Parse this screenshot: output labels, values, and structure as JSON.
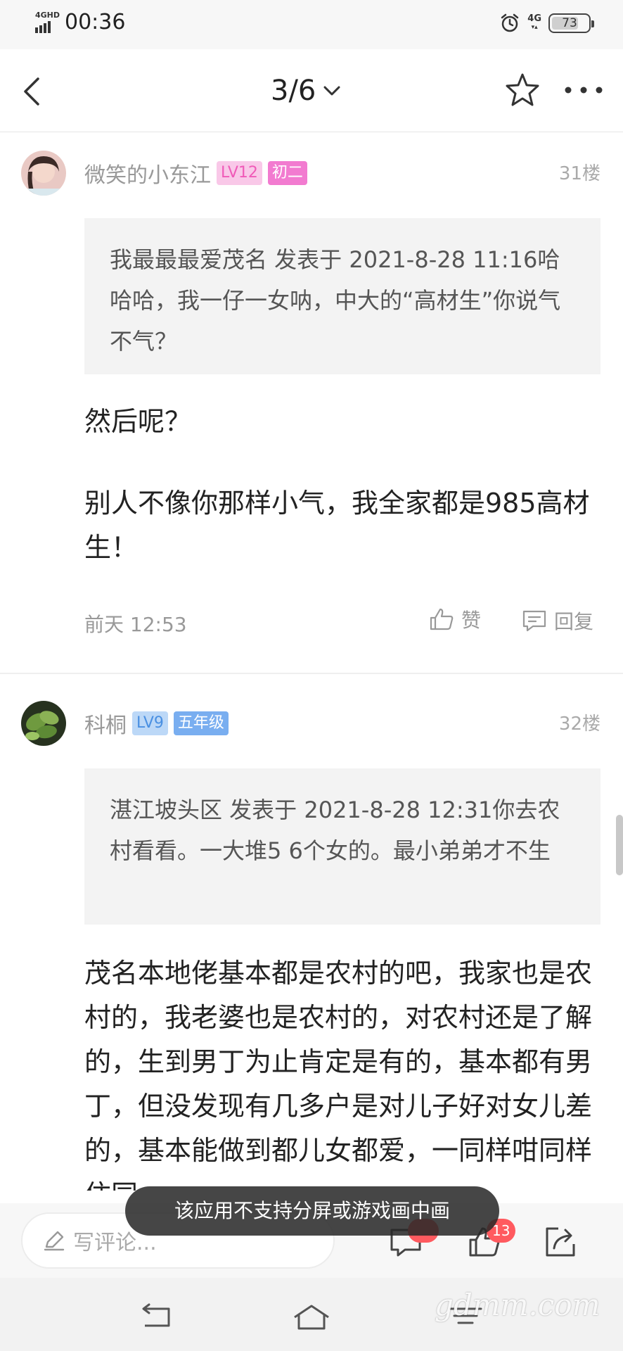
{
  "status_bar": {
    "network": "4GHD",
    "time": "00:36",
    "net_right": "4G",
    "battery": "73",
    "battery_level": 0.73
  },
  "header": {
    "page_indicator": "3/6"
  },
  "posts": [
    {
      "username": "微笑的小东江",
      "badges": [
        {
          "text": "LV12",
          "bg": "#f9c8e8",
          "color": "#f05ab8"
        },
        {
          "text": "初二",
          "bg": "#f27bd0",
          "color": "#ffffff"
        }
      ],
      "floor": "31楼",
      "quote": "我最最最爱茂名 发表于 2021-8-28 11:16哈哈哈，我一仔一女呐，中大的“高材生”你说气不气？",
      "paragraphs": [
        "然后呢？",
        "别人不像你那样小气，我全家都是985高材生！"
      ],
      "time": "前天 12:53",
      "like_label": "赞",
      "reply_label": "回复"
    },
    {
      "username": "科桐",
      "badges": [
        {
          "text": "LV9",
          "bg": "#bcd8f7",
          "color": "#4a90e2"
        },
        {
          "text": "五年级",
          "bg": "#79aef0",
          "color": "#ffffff"
        }
      ],
      "floor": "32楼",
      "quote": "湛江坡头区 发表于 2021-8-28 12:31你去农村看看。一大堆5 6个女的。最小弟弟才不生",
      "paragraphs": [
        "茂名本地佬基本都是农村的吧，我家也是农村的，我老婆也是农村的，对农村还是了解的，生到男丁为止肯定是有的，基本都有男丁，但没发现有几多户是对儿子好对女儿差的，基本能做到都儿女都爱，一同样咁同样住同"
      ]
    }
  ],
  "bottom_bar": {
    "comment_placeholder": "写评论...",
    "likes_count": "13"
  },
  "toast": "该应用不支持分屏或游戏画中画",
  "watermark": "gdmm.com"
}
